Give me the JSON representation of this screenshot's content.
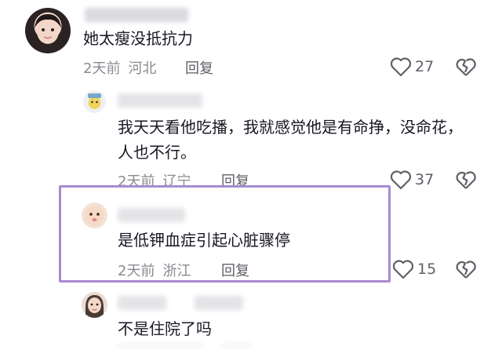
{
  "comments": [
    {
      "text": "她太瘦没抵抗力",
      "time": "2天前",
      "location": "河北",
      "reply_label": "回复",
      "likes": "27",
      "avatar_icon": "girl-avatar-icon"
    },
    {
      "text_lines": [
        "我天天看他吃播，我就感觉他是有命挣，没命花，",
        "人也不行。"
      ],
      "time": "2天前",
      "location": "辽宁",
      "reply_label": "回复",
      "likes": "37",
      "avatar_icon": "cartoon-avatar-icon"
    },
    {
      "text": "是低钾血症引起心脏骤停",
      "time": "2天前",
      "location": "浙江",
      "reply_label": "回复",
      "likes": "15",
      "avatar_icon": "baby-avatar-icon",
      "highlighted": true
    },
    {
      "text": "不是住院了吗",
      "avatar_icon": "woman-avatar-icon"
    }
  ],
  "colors": {
    "highlight_border": "#a88bd0",
    "meta_text": "#8a8b91",
    "body_text": "#161823"
  }
}
